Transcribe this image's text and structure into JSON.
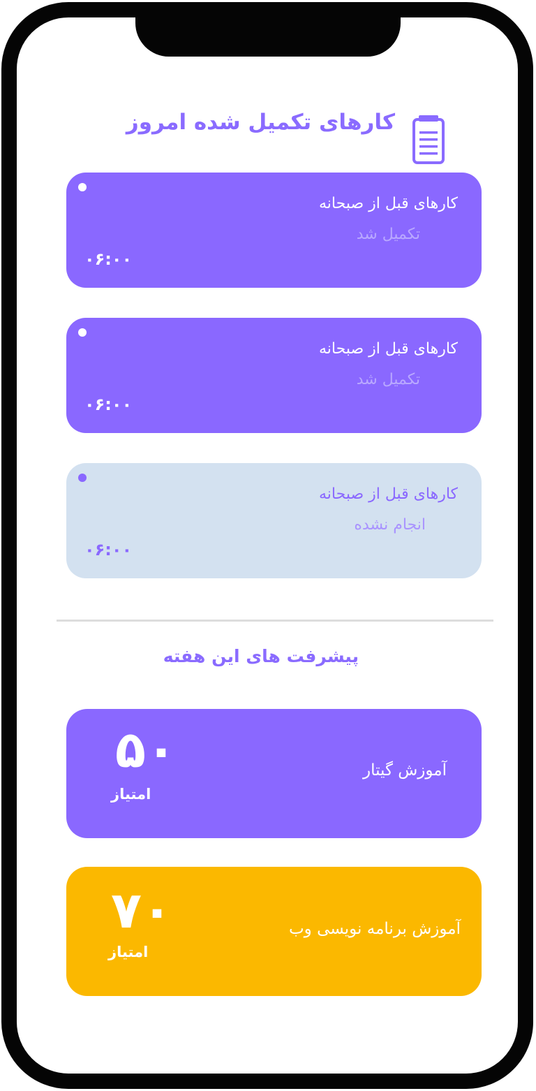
{
  "header": {
    "title": "کارهای تکمیل شده امروز",
    "icon": "clipboard-icon"
  },
  "tasks": [
    {
      "title": "کارهای قبل از صبحانه",
      "status": "تکمیل شد",
      "time": "۰۶:۰۰",
      "state": "done"
    },
    {
      "title": "کارهای قبل از صبحانه",
      "status": "تکمیل شد",
      "time": "۰۶:۰۰",
      "state": "done"
    },
    {
      "title": "کارهای قبل از صبحانه",
      "status": "انجام نشده",
      "time": "۰۶:۰۰",
      "state": "pending"
    }
  ],
  "weekly": {
    "title": "پیشرفت های این هفته",
    "items": [
      {
        "course": "آموزش گیتار",
        "points": "۵۰",
        "unit": "امتیاز",
        "color": "#8a68ff"
      },
      {
        "course": "آموزش  برنامه نویسی وب",
        "points": "۷۰",
        "unit": "امتیاز",
        "color": "#fbb800"
      }
    ]
  },
  "colors": {
    "accent": "#8a68ff",
    "pending_bg": "#d3e1f0",
    "highlight": "#fbb800",
    "frame": "#050505"
  }
}
